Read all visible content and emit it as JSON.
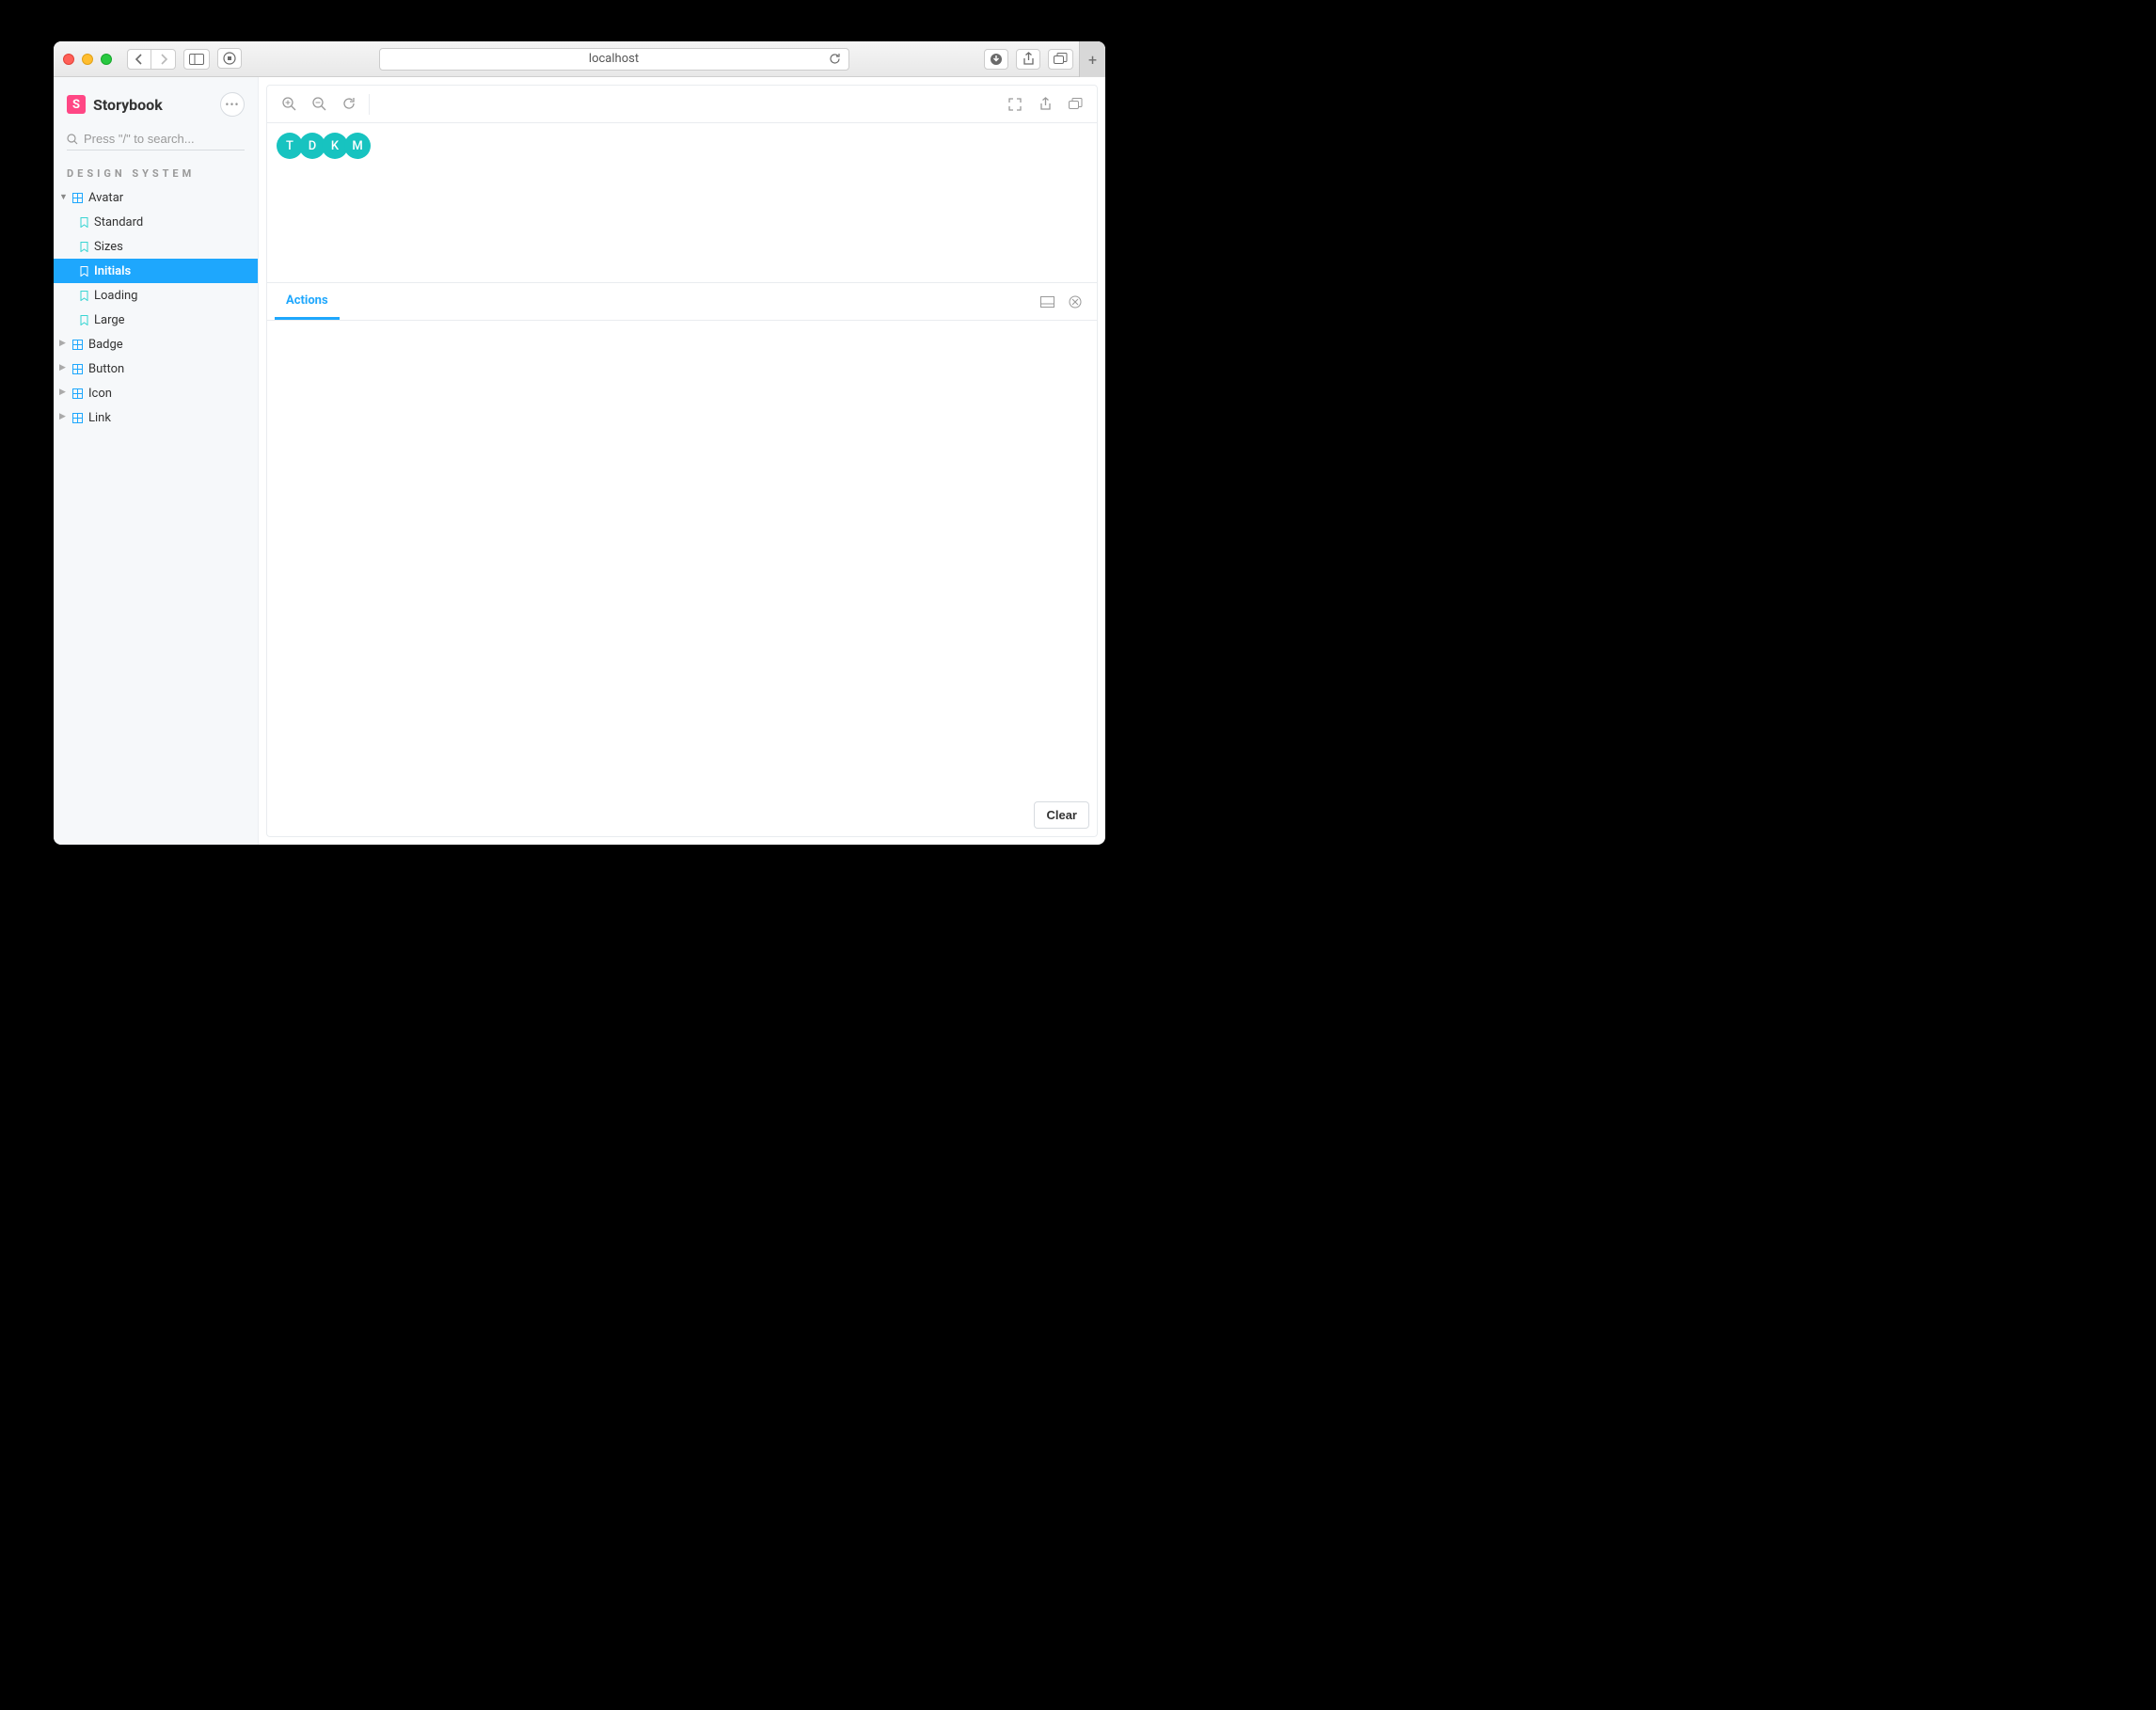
{
  "browser": {
    "url": "localhost"
  },
  "app": {
    "name": "Storybook"
  },
  "search": {
    "placeholder": "Press \"/\" to search..."
  },
  "sidebar": {
    "heading": "DESIGN SYSTEM",
    "tree": {
      "avatar": {
        "label": "Avatar",
        "stories": [
          {
            "label": "Standard"
          },
          {
            "label": "Sizes"
          },
          {
            "label": "Initials"
          },
          {
            "label": "Loading"
          },
          {
            "label": "Large"
          }
        ]
      },
      "others": [
        {
          "label": "Badge"
        },
        {
          "label": "Button"
        },
        {
          "label": "Icon"
        },
        {
          "label": "Link"
        }
      ]
    }
  },
  "canvas": {
    "avatars": [
      "T",
      "D",
      "K",
      "M"
    ]
  },
  "addons": {
    "tabs": [
      {
        "label": "Actions"
      }
    ],
    "clear_label": "Clear"
  }
}
